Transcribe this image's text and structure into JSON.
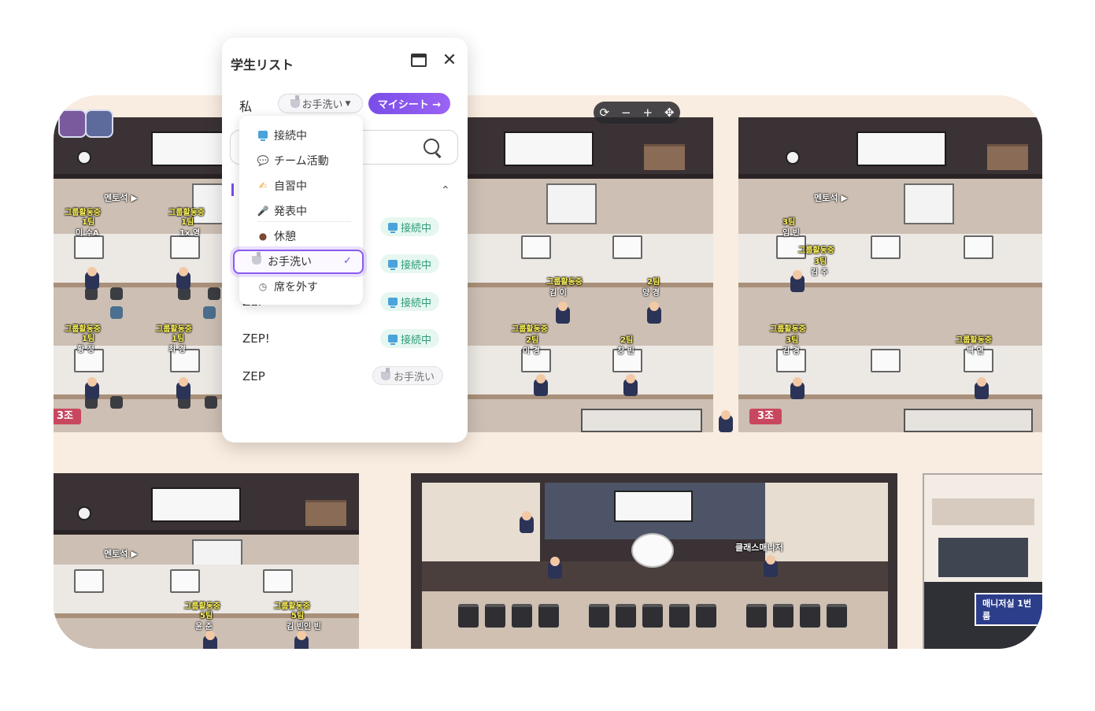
{
  "panel": {
    "title": "学生リスト",
    "me_label": "私",
    "my_status": "お手洗い",
    "my_seat_button": "マイシート →",
    "search_placeholder": ""
  },
  "dropdown": {
    "options": [
      "接続中",
      "チーム活動",
      "自習中",
      "発表中",
      "休憩",
      "お手洗い",
      "席を外す"
    ],
    "selected": "お手洗い"
  },
  "students": [
    {
      "name": "",
      "status": "接続中"
    },
    {
      "name": "",
      "status": "接続中"
    },
    {
      "name": "ZEP",
      "status": "接続中"
    },
    {
      "name": "ZEP!",
      "status": "接続中"
    },
    {
      "name": "ZEP",
      "status": "お手洗い"
    }
  ],
  "map": {
    "toolbar": {
      "reset": "⟳",
      "zoom_out": "−",
      "zoom_in": "+",
      "move": "✥"
    },
    "mentor_label": "멘토석 ▶",
    "group_tag": "그룹활동중",
    "team_signs": [
      "3조",
      "3조"
    ],
    "manager_label": "클래스매니저",
    "room_sign": "매니저실 1번룸",
    "team_labels": [
      "1팀",
      "1팀",
      "1팀",
      "1팀",
      "2팀",
      "2팀",
      "2팀",
      "3팀",
      "3팀",
      "3팀",
      "5팀",
      "5팀"
    ],
    "desk_names": [
      "이 수A",
      "1x 영",
      "황 정",
      "최 경",
      "김 이",
      "양 경",
      "이 경",
      "창 빈",
      "임 빈",
      "김 주",
      "김 경",
      "백 연",
      "윤 준",
      "김 빈인 빈"
    ]
  }
}
